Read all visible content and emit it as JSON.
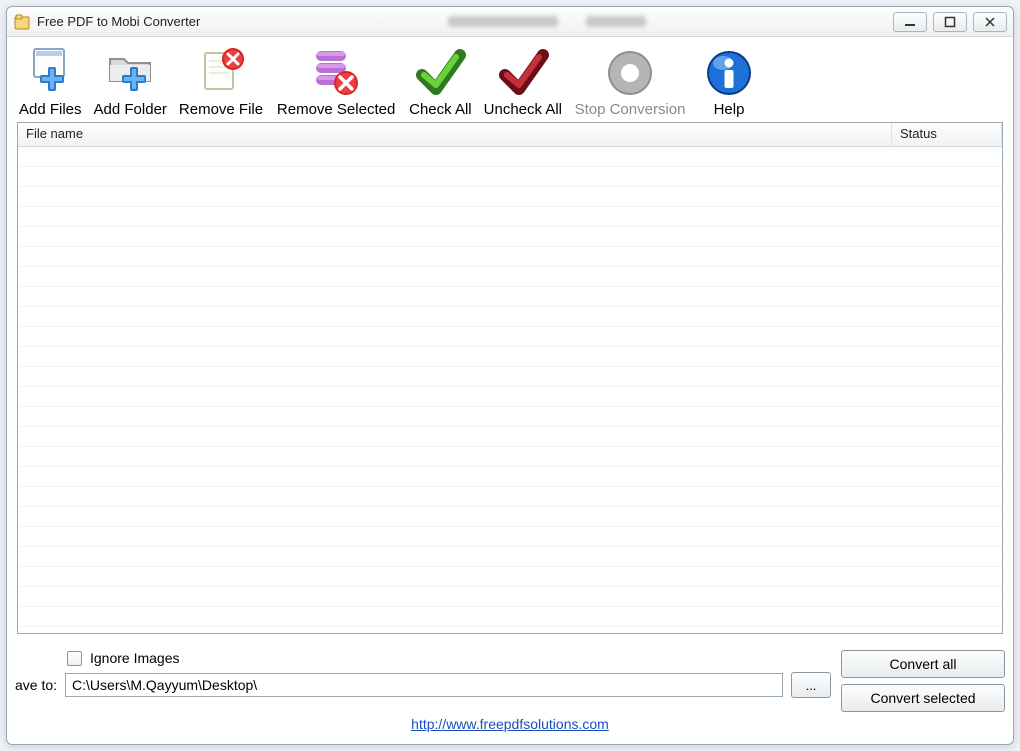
{
  "window": {
    "title": "Free PDF to Mobi Converter"
  },
  "toolbar": {
    "add_files": "Add Files",
    "add_folder": "Add Folder",
    "remove_file": "Remove File",
    "remove_selected": "Remove Selected",
    "check_all": "Check All",
    "uncheck_all": "Uncheck All",
    "stop_conversion": "Stop Conversion",
    "help": "Help"
  },
  "list": {
    "col_filename": "File name",
    "col_status": "Status",
    "rows": []
  },
  "bottom": {
    "ignore_images": "Ignore Images",
    "ignore_images_checked": false,
    "save_to_label": "ave to:",
    "save_to_path": "C:\\Users\\M.Qayyum\\Desktop\\",
    "browse": "...",
    "convert_all": "Convert all",
    "convert_selected": "Convert selected",
    "link_text": "http://www.freepdfsolutions.com",
    "link_href": "http://www.freepdfsolutions.com"
  }
}
